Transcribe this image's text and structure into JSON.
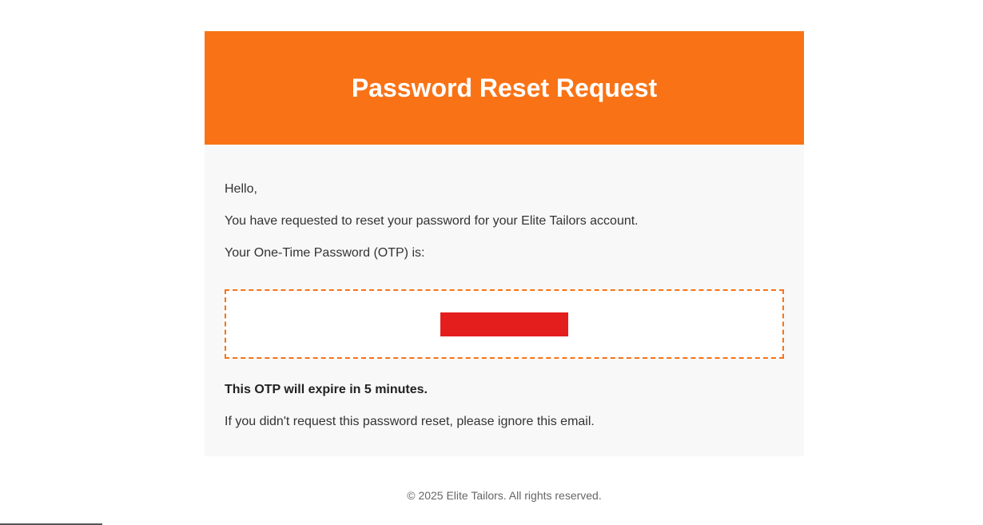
{
  "header": {
    "title": "Password Reset Request"
  },
  "body": {
    "greeting": "Hello,",
    "request_line": "You have requested to reset your password for your Elite Tailors account.",
    "otp_intro": "Your One-Time Password (OTP) is:",
    "otp_code": "",
    "expire_notice": "This OTP will expire in 5 minutes.",
    "ignore_notice": "If you didn't request this password reset, please ignore this email."
  },
  "footer": {
    "copyright": "© 2025 Elite Tailors. All rights reserved."
  },
  "colors": {
    "brand_orange": "#f97316",
    "otp_redaction": "#e41d1d",
    "body_background": "#f8f8f8"
  }
}
